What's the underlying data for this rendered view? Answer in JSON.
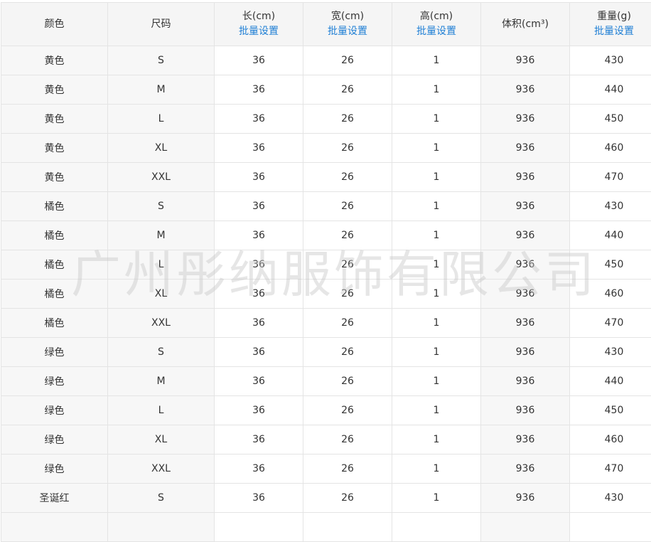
{
  "columns": [
    {
      "label": "颜色",
      "link": ""
    },
    {
      "label": "尺码",
      "link": ""
    },
    {
      "label": "长(cm)",
      "link": "批量设置"
    },
    {
      "label": "宽(cm)",
      "link": "批量设置"
    },
    {
      "label": "高(cm)",
      "link": "批量设置"
    },
    {
      "label": "体积(cm³)",
      "link": ""
    },
    {
      "label": "重量(g)",
      "link": "批量设置"
    }
  ],
  "rows": [
    [
      "黄色",
      "S",
      "36",
      "26",
      "1",
      "936",
      "430"
    ],
    [
      "黄色",
      "M",
      "36",
      "26",
      "1",
      "936",
      "440"
    ],
    [
      "黄色",
      "L",
      "36",
      "26",
      "1",
      "936",
      "450"
    ],
    [
      "黄色",
      "XL",
      "36",
      "26",
      "1",
      "936",
      "460"
    ],
    [
      "黄色",
      "XXL",
      "36",
      "26",
      "1",
      "936",
      "470"
    ],
    [
      "橘色",
      "S",
      "36",
      "26",
      "1",
      "936",
      "430"
    ],
    [
      "橘色",
      "M",
      "36",
      "26",
      "1",
      "936",
      "440"
    ],
    [
      "橘色",
      "L",
      "36",
      "26",
      "1",
      "936",
      "450"
    ],
    [
      "橘色",
      "XL",
      "36",
      "26",
      "1",
      "936",
      "460"
    ],
    [
      "橘色",
      "XXL",
      "36",
      "26",
      "1",
      "936",
      "470"
    ],
    [
      "绿色",
      "S",
      "36",
      "26",
      "1",
      "936",
      "430"
    ],
    [
      "绿色",
      "M",
      "36",
      "26",
      "1",
      "936",
      "440"
    ],
    [
      "绿色",
      "L",
      "36",
      "26",
      "1",
      "936",
      "450"
    ],
    [
      "绿色",
      "XL",
      "36",
      "26",
      "1",
      "936",
      "460"
    ],
    [
      "绿色",
      "XXL",
      "36",
      "26",
      "1",
      "936",
      "470"
    ],
    [
      "圣诞红",
      "S",
      "36",
      "26",
      "1",
      "936",
      "430"
    ],
    [
      "",
      "",
      "",
      "",
      "",
      "",
      ""
    ]
  ],
  "watermark": "广州彤纳服饰有限公司"
}
